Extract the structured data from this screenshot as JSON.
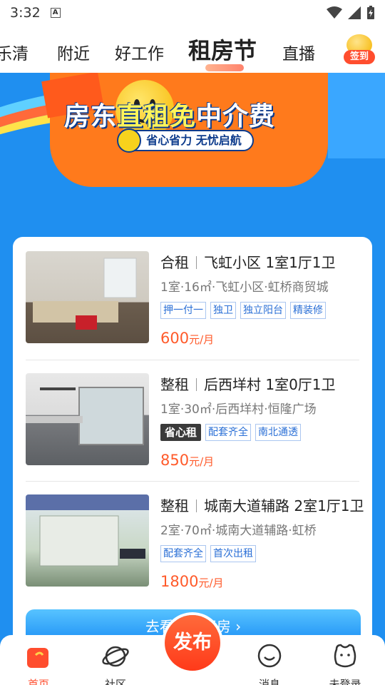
{
  "status_bar": {
    "time": "3:32",
    "notif_badge": "A"
  },
  "tabs": [
    {
      "label": "乐清"
    },
    {
      "label": "附近"
    },
    {
      "label": "好工作"
    },
    {
      "label": "租房节"
    },
    {
      "label": "直播"
    }
  ],
  "sign_in": {
    "label": "签到"
  },
  "banner": {
    "headline_part1": "房东",
    "headline_part2": "直租",
    "headline_part3": "免",
    "headline_part4": "中介费",
    "subline": "省心省力 无忧启航"
  },
  "listings": [
    {
      "type": "合租",
      "title": "飞虹小区 1室1厅1卫",
      "meta": "1室·16㎡·飞虹小区·虹桥商贸城",
      "tags": [
        "押一付一",
        "独卫",
        "独立阳台",
        "精装修"
      ],
      "price": "600",
      "unit": "元/月"
    },
    {
      "type": "整租",
      "title": "后西垟村 1室0厅1卫",
      "meta": "1室·30㎡·后西垟村·恒隆广场",
      "badge": "省心租",
      "tags": [
        "配套齐全",
        "南北通透"
      ],
      "price": "850",
      "unit": "元/月"
    },
    {
      "type": "整租",
      "title": "城南大道辅路 2室1厅1卫",
      "meta": "2室·70㎡·城南大道辅路·虹桥",
      "tags": [
        "配套齐全",
        "首次出租"
      ],
      "price": "1800",
      "unit": "元/月"
    }
  ],
  "more_button": {
    "label": "去看更多好房"
  },
  "bottom_nav": {
    "home": "首页",
    "community": "社区",
    "publish": "发布",
    "messages": "消息",
    "profile": "未登录"
  },
  "colors": {
    "accent": "#ff4d2e",
    "price": "#ff5a2a",
    "tag": "#2a6fd6",
    "bg_blue": "#1f8ff0"
  }
}
